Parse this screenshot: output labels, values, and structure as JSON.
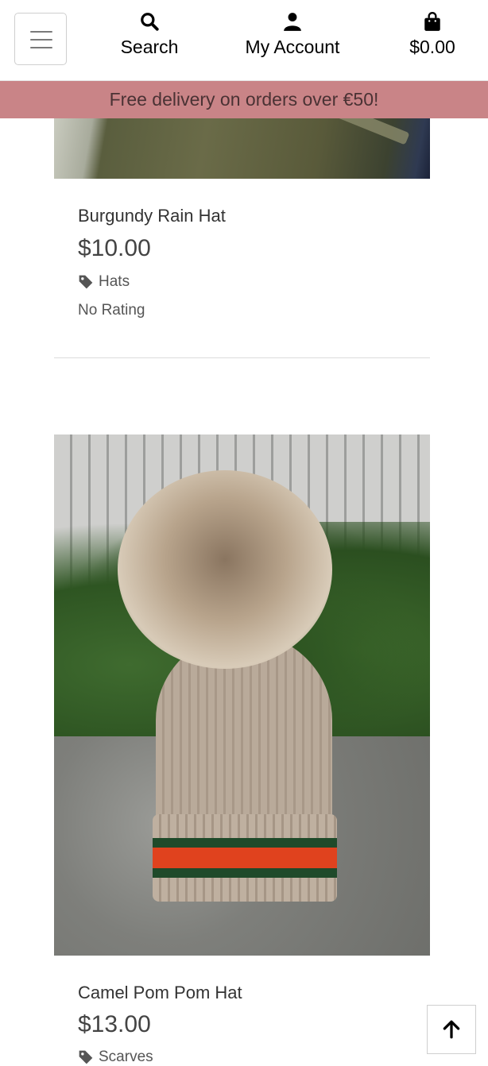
{
  "header": {
    "menu_icon": "hamburger-icon",
    "search_label": "Search",
    "search_icon": "search-icon",
    "account_label": "My Account",
    "account_icon": "user-icon",
    "cart_total": "$0.00",
    "cart_icon": "shopping-bag-icon"
  },
  "banner": {
    "text": "Free delivery on orders over €50!",
    "color": "#c98487"
  },
  "products": [
    {
      "name": "Burgundy Rain Hat",
      "price": "$10.00",
      "category": "Hats",
      "rating": "No Rating"
    },
    {
      "name": "Camel Pom Pom Hat",
      "price": "$13.00",
      "category": "Scarves"
    }
  ],
  "back_to_top": {
    "icon": "arrow-up-icon"
  }
}
